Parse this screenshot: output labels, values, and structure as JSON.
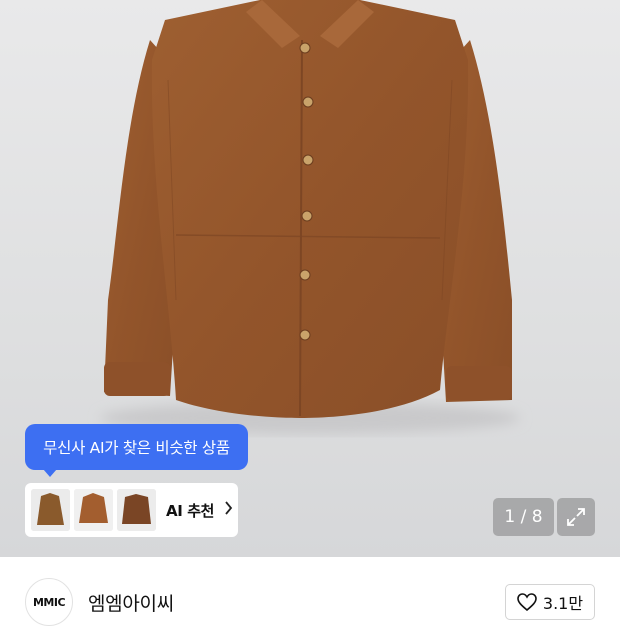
{
  "product_image": {
    "alt": "suede shirt",
    "main_color": "#94562c"
  },
  "ai_tooltip": {
    "text": "무신사 AI가 찾은 비슷한 상품",
    "bg": "#3d6ff2"
  },
  "ai_recommend": {
    "label": "AI 추천",
    "chevron": "chevron-right-icon",
    "thumbnails": [
      {
        "name": "similar-item-1",
        "color": "#8a5a2c"
      },
      {
        "name": "similar-item-2",
        "color": "#a35e2f"
      },
      {
        "name": "similar-item-3",
        "color": "#7a4525"
      }
    ]
  },
  "gallery": {
    "pager_text": "1 / 8",
    "expand_icon": "expand-icon"
  },
  "brand": {
    "logo_text": "MMIC",
    "name": "엠엠아이씨"
  },
  "like": {
    "icon": "heart-icon",
    "count": "3.1만"
  }
}
